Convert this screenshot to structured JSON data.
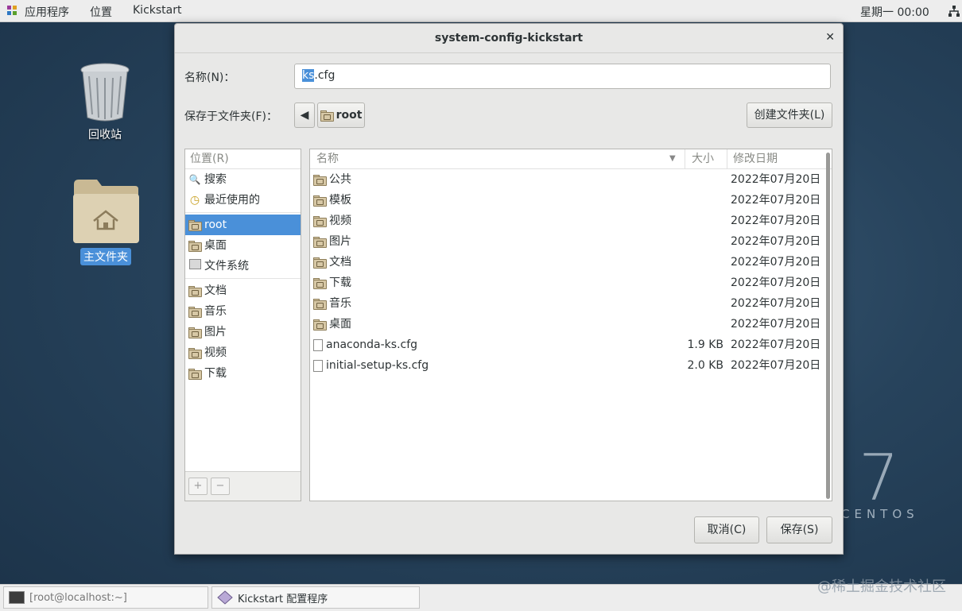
{
  "topbar": {
    "apps_label": "应用程序",
    "places_label": "位置",
    "kickstart_label": "Kickstart",
    "clock": "星期一 00:00"
  },
  "desktop": {
    "trash_label": "回收站",
    "home_label": "主文件夹",
    "brand_number": "7",
    "brand_text": "CENTOS"
  },
  "dialog": {
    "title": "system-config-kickstart",
    "name_label": "名称(N)：",
    "filename_selected": "ks",
    "filename_rest": ".cfg",
    "save_in_label": "保存于文件夹(F)：",
    "path_label": "root",
    "create_folder_label": "创建文件夹(L)",
    "places_header": "位置(R)",
    "places": [
      {
        "label": "搜索",
        "icon": "search-icon"
      },
      {
        "label": "最近使用的",
        "icon": "recent-icon"
      },
      {
        "label": "root",
        "icon": "home-folder-icon",
        "selected": true
      },
      {
        "label": "桌面",
        "icon": "desktop-folder-icon"
      },
      {
        "label": "文件系统",
        "icon": "drive-icon"
      },
      {
        "label": "文档",
        "icon": "documents-folder-icon"
      },
      {
        "label": "音乐",
        "icon": "music-folder-icon"
      },
      {
        "label": "图片",
        "icon": "pictures-folder-icon"
      },
      {
        "label": "视频",
        "icon": "videos-folder-icon"
      },
      {
        "label": "下载",
        "icon": "downloads-folder-icon"
      }
    ],
    "add_button": "+",
    "remove_button": "−",
    "columns": {
      "name": "名称",
      "size": "大小",
      "modified": "修改日期"
    },
    "files": [
      {
        "name": "公共",
        "size": "",
        "modified": "2022年07月20日",
        "type": "folder"
      },
      {
        "name": "模板",
        "size": "",
        "modified": "2022年07月20日",
        "type": "folder"
      },
      {
        "name": "视频",
        "size": "",
        "modified": "2022年07月20日",
        "type": "folder"
      },
      {
        "name": "图片",
        "size": "",
        "modified": "2022年07月20日",
        "type": "folder"
      },
      {
        "name": "文档",
        "size": "",
        "modified": "2022年07月20日",
        "type": "folder"
      },
      {
        "name": "下载",
        "size": "",
        "modified": "2022年07月20日",
        "type": "folder"
      },
      {
        "name": "音乐",
        "size": "",
        "modified": "2022年07月20日",
        "type": "folder"
      },
      {
        "name": "桌面",
        "size": "",
        "modified": "2022年07月20日",
        "type": "folder"
      },
      {
        "name": "anaconda-ks.cfg",
        "size": "1.9 KB",
        "modified": "2022年07月20日",
        "type": "file"
      },
      {
        "name": "initial-setup-ks.cfg",
        "size": "2.0 KB",
        "modified": "2022年07月20日",
        "type": "file"
      }
    ],
    "cancel_label": "取消(C)",
    "save_label": "保存(S)"
  },
  "taskbar": {
    "terminal_label": "[root@localhost:~]",
    "kickstart_task_label": "Kickstart 配置程序"
  },
  "watermark": "@稀土掘金技术社区"
}
